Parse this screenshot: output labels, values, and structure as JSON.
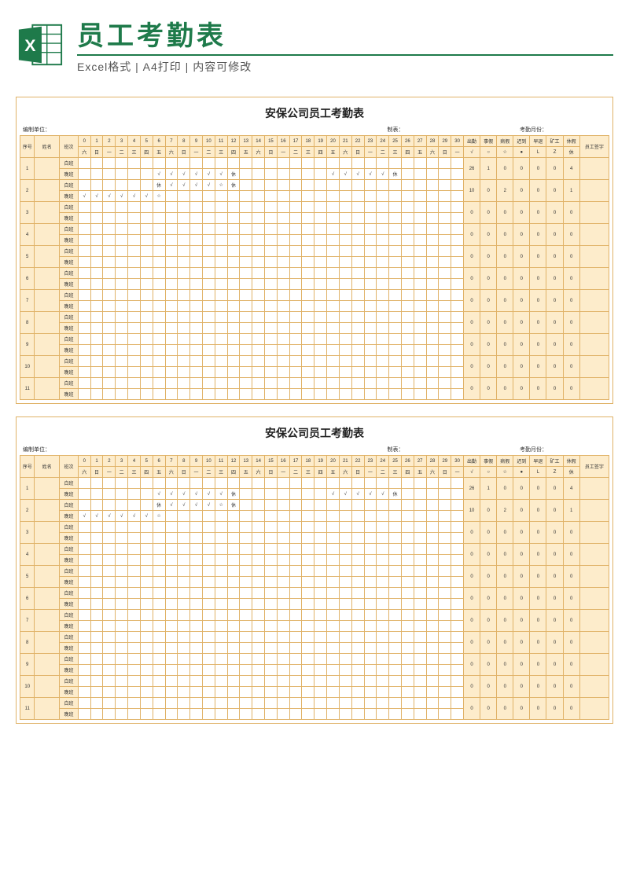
{
  "header": {
    "title": "员工考勤表",
    "subtitle": "Excel格式 | A4打印 | 内容可修改"
  },
  "sheet_title": "安保公司员工考勤表",
  "meta": {
    "unit_label": "编制单位：",
    "maker_label": "制表：",
    "month_label": "考勤月份："
  },
  "columns": {
    "seq": "序号",
    "name": "姓名",
    "shift": "班次",
    "signature": "员工签字"
  },
  "shift_labels": {
    "day": "白班",
    "night": "晚班"
  },
  "day_numbers": [
    "0",
    "1",
    "2",
    "3",
    "4",
    "5",
    "6",
    "7",
    "8",
    "9",
    "10",
    "11",
    "12",
    "13",
    "14",
    "15",
    "16",
    "17",
    "18",
    "19",
    "20",
    "21",
    "22",
    "23",
    "24",
    "25",
    "26",
    "27",
    "28",
    "29",
    "30"
  ],
  "weekdays": [
    "六",
    "日",
    "一",
    "二",
    "三",
    "四",
    "五",
    "六",
    "日",
    "一",
    "二",
    "三",
    "四",
    "五",
    "六",
    "日",
    "一",
    "二",
    "三",
    "四",
    "五",
    "六",
    "日",
    "一",
    "二",
    "三",
    "四",
    "五",
    "六",
    "日",
    "一"
  ],
  "stat_headers": [
    "出勤",
    "事假",
    "病假",
    "迟到",
    "早退",
    "矿工",
    "休假"
  ],
  "stat_symbols": [
    "√",
    "○",
    "☆",
    "●",
    "L",
    "Z",
    "○",
    "休"
  ],
  "chart_data": {
    "type": "table",
    "title": "安保公司员工考勤表",
    "legend_symbols": {
      "出勤": "√",
      "事假": "○",
      "病假": "☆",
      "迟到": "●",
      "早退": "L",
      "矿工": "Z",
      "休假": "休"
    },
    "employees": [
      {
        "seq": 1,
        "day_marks": [
          "",
          "",
          "",
          "",
          "",
          "",
          "",
          "",
          "",
          "",
          "",
          "",
          "",
          "",
          "",
          "",
          "",
          "",
          "",
          "",
          "",
          "",
          "",
          "",
          "",
          "",
          "",
          "",
          "",
          "",
          ""
        ],
        "night_marks": [
          "",
          "",
          "",
          "",
          "",
          "",
          "√",
          "√",
          "√",
          "√",
          "√",
          "√",
          "休",
          "",
          "",
          "",
          "",
          "",
          "",
          "",
          "√",
          "√",
          "√",
          "√",
          "√",
          "休",
          "",
          "",
          "",
          "",
          ""
        ],
        "stats": {
          "出勤": 26,
          "事假": 1,
          "病假": 0,
          "迟到": 0,
          "早退": 0,
          "矿工": 0,
          "休假": 4
        }
      },
      {
        "seq": 2,
        "day_marks": [
          "",
          "",
          "",
          "",
          "",
          "",
          "休",
          "√",
          "√",
          "√",
          "√",
          "☆",
          "休",
          "",
          "",
          "",
          "",
          "",
          "",
          "",
          "",
          "",
          "",
          "",
          "",
          "",
          "",
          "",
          "",
          "",
          ""
        ],
        "night_marks": [
          "√",
          "√",
          "√",
          "√",
          "√",
          "√",
          "☆",
          "",
          "",
          "",
          "",
          "",
          "",
          "",
          "",
          "",
          "",
          "",
          "",
          "",
          "",
          "",
          "",
          "",
          "",
          "",
          "",
          "",
          "",
          "",
          ""
        ],
        "stats": {
          "出勤": 10,
          "事假": 0,
          "病假": 2,
          "迟到": 0,
          "早退": 0,
          "矿工": 0,
          "休假": 1
        }
      },
      {
        "seq": 3,
        "day_marks": [
          "",
          "",
          "",
          "",
          "",
          "",
          "",
          "",
          "",
          "",
          "",
          "",
          "",
          "",
          "",
          "",
          "",
          "",
          "",
          "",
          "",
          "",
          "",
          "",
          "",
          "",
          "",
          "",
          "",
          "",
          ""
        ],
        "night_marks": [
          "",
          "",
          "",
          "",
          "",
          "",
          "",
          "",
          "",
          "",
          "",
          "",
          "",
          "",
          "",
          "",
          "",
          "",
          "",
          "",
          "",
          "",
          "",
          "",
          "",
          "",
          "",
          "",
          "",
          "",
          ""
        ],
        "stats": {
          "出勤": 0,
          "事假": 0,
          "病假": 0,
          "迟到": 0,
          "早退": 0,
          "矿工": 0,
          "休假": 0
        }
      },
      {
        "seq": 4,
        "day_marks": [
          "",
          "",
          "",
          "",
          "",
          "",
          "",
          "",
          "",
          "",
          "",
          "",
          "",
          "",
          "",
          "",
          "",
          "",
          "",
          "",
          "",
          "",
          "",
          "",
          "",
          "",
          "",
          "",
          "",
          "",
          ""
        ],
        "night_marks": [
          "",
          "",
          "",
          "",
          "",
          "",
          "",
          "",
          "",
          "",
          "",
          "",
          "",
          "",
          "",
          "",
          "",
          "",
          "",
          "",
          "",
          "",
          "",
          "",
          "",
          "",
          "",
          "",
          "",
          "",
          ""
        ],
        "stats": {
          "出勤": 0,
          "事假": 0,
          "病假": 0,
          "迟到": 0,
          "早退": 0,
          "矿工": 0,
          "休假": 0
        }
      },
      {
        "seq": 5,
        "day_marks": [
          "",
          "",
          "",
          "",
          "",
          "",
          "",
          "",
          "",
          "",
          "",
          "",
          "",
          "",
          "",
          "",
          "",
          "",
          "",
          "",
          "",
          "",
          "",
          "",
          "",
          "",
          "",
          "",
          "",
          "",
          ""
        ],
        "night_marks": [
          "",
          "",
          "",
          "",
          "",
          "",
          "",
          "",
          "",
          "",
          "",
          "",
          "",
          "",
          "",
          "",
          "",
          "",
          "",
          "",
          "",
          "",
          "",
          "",
          "",
          "",
          "",
          "",
          "",
          "",
          ""
        ],
        "stats": {
          "出勤": 0,
          "事假": 0,
          "病假": 0,
          "迟到": 0,
          "早退": 0,
          "矿工": 0,
          "休假": 0
        }
      },
      {
        "seq": 6,
        "day_marks": [
          "",
          "",
          "",
          "",
          "",
          "",
          "",
          "",
          "",
          "",
          "",
          "",
          "",
          "",
          "",
          "",
          "",
          "",
          "",
          "",
          "",
          "",
          "",
          "",
          "",
          "",
          "",
          "",
          "",
          "",
          ""
        ],
        "night_marks": [
          "",
          "",
          "",
          "",
          "",
          "",
          "",
          "",
          "",
          "",
          "",
          "",
          "",
          "",
          "",
          "",
          "",
          "",
          "",
          "",
          "",
          "",
          "",
          "",
          "",
          "",
          "",
          "",
          "",
          "",
          ""
        ],
        "stats": {
          "出勤": 0,
          "事假": 0,
          "病假": 0,
          "迟到": 0,
          "早退": 0,
          "矿工": 0,
          "休假": 0
        }
      },
      {
        "seq": 7,
        "day_marks": [
          "",
          "",
          "",
          "",
          "",
          "",
          "",
          "",
          "",
          "",
          "",
          "",
          "",
          "",
          "",
          "",
          "",
          "",
          "",
          "",
          "",
          "",
          "",
          "",
          "",
          "",
          "",
          "",
          "",
          "",
          ""
        ],
        "night_marks": [
          "",
          "",
          "",
          "",
          "",
          "",
          "",
          "",
          "",
          "",
          "",
          "",
          "",
          "",
          "",
          "",
          "",
          "",
          "",
          "",
          "",
          "",
          "",
          "",
          "",
          "",
          "",
          "",
          "",
          "",
          ""
        ],
        "stats": {
          "出勤": 0,
          "事假": 0,
          "病假": 0,
          "迟到": 0,
          "早退": 0,
          "矿工": 0,
          "休假": 0
        }
      },
      {
        "seq": 8,
        "day_marks": [
          "",
          "",
          "",
          "",
          "",
          "",
          "",
          "",
          "",
          "",
          "",
          "",
          "",
          "",
          "",
          "",
          "",
          "",
          "",
          "",
          "",
          "",
          "",
          "",
          "",
          "",
          "",
          "",
          "",
          "",
          ""
        ],
        "night_marks": [
          "",
          "",
          "",
          "",
          "",
          "",
          "",
          "",
          "",
          "",
          "",
          "",
          "",
          "",
          "",
          "",
          "",
          "",
          "",
          "",
          "",
          "",
          "",
          "",
          "",
          "",
          "",
          "",
          "",
          "",
          ""
        ],
        "stats": {
          "出勤": 0,
          "事假": 0,
          "病假": 0,
          "迟到": 0,
          "早退": 0,
          "矿工": 0,
          "休假": 0
        }
      },
      {
        "seq": 9,
        "day_marks": [
          "",
          "",
          "",
          "",
          "",
          "",
          "",
          "",
          "",
          "",
          "",
          "",
          "",
          "",
          "",
          "",
          "",
          "",
          "",
          "",
          "",
          "",
          "",
          "",
          "",
          "",
          "",
          "",
          "",
          "",
          ""
        ],
        "night_marks": [
          "",
          "",
          "",
          "",
          "",
          "",
          "",
          "",
          "",
          "",
          "",
          "",
          "",
          "",
          "",
          "",
          "",
          "",
          "",
          "",
          "",
          "",
          "",
          "",
          "",
          "",
          "",
          "",
          "",
          "",
          ""
        ],
        "stats": {
          "出勤": 0,
          "事假": 0,
          "病假": 0,
          "迟到": 0,
          "早退": 0,
          "矿工": 0,
          "休假": 0
        }
      },
      {
        "seq": 10,
        "day_marks": [
          "",
          "",
          "",
          "",
          "",
          "",
          "",
          "",
          "",
          "",
          "",
          "",
          "",
          "",
          "",
          "",
          "",
          "",
          "",
          "",
          "",
          "",
          "",
          "",
          "",
          "",
          "",
          "",
          "",
          "",
          ""
        ],
        "night_marks": [
          "",
          "",
          "",
          "",
          "",
          "",
          "",
          "",
          "",
          "",
          "",
          "",
          "",
          "",
          "",
          "",
          "",
          "",
          "",
          "",
          "",
          "",
          "",
          "",
          "",
          "",
          "",
          "",
          "",
          "",
          ""
        ],
        "stats": {
          "出勤": 0,
          "事假": 0,
          "病假": 0,
          "迟到": 0,
          "早退": 0,
          "矿工": 0,
          "休假": 0
        }
      },
      {
        "seq": 11,
        "day_marks": [
          "",
          "",
          "",
          "",
          "",
          "",
          "",
          "",
          "",
          "",
          "",
          "",
          "",
          "",
          "",
          "",
          "",
          "",
          "",
          "",
          "",
          "",
          "",
          "",
          "",
          "",
          "",
          "",
          "",
          "",
          ""
        ],
        "night_marks": [
          "",
          "",
          "",
          "",
          "",
          "",
          "",
          "",
          "",
          "",
          "",
          "",
          "",
          "",
          "",
          "",
          "",
          "",
          "",
          "",
          "",
          "",
          "",
          "",
          "",
          "",
          "",
          "",
          "",
          "",
          ""
        ],
        "stats": {
          "出勤": 0,
          "事假": 0,
          "病假": 0,
          "迟到": 0,
          "早退": 0,
          "矿工": 0,
          "休假": 0
        }
      }
    ]
  }
}
